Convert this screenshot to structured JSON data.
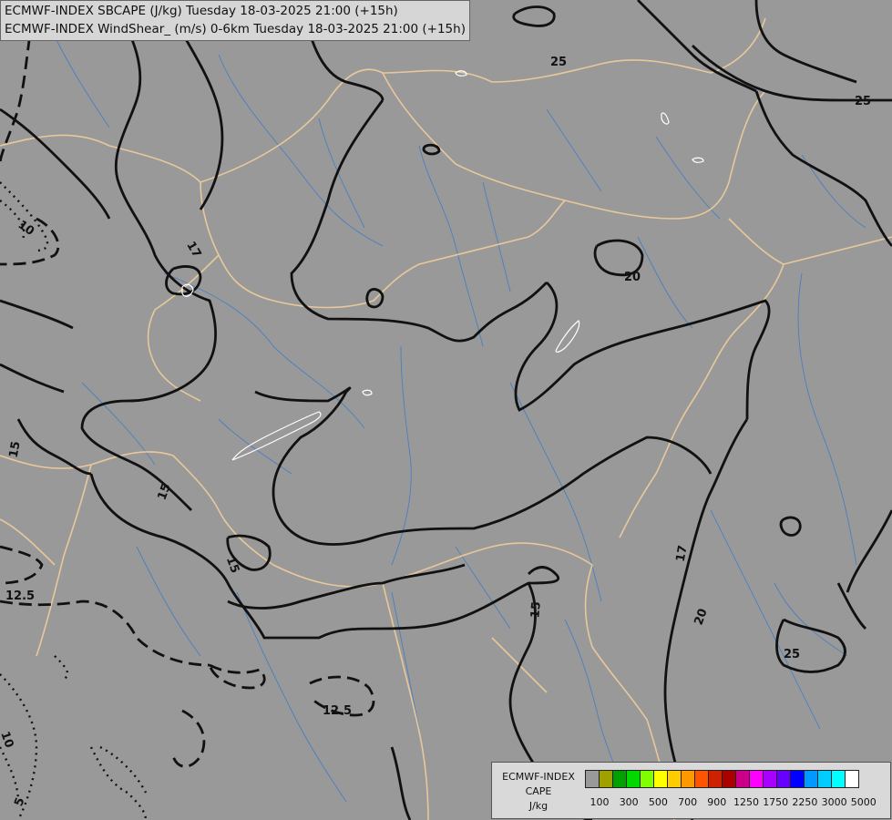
{
  "header": {
    "line1": "ECMWF-INDEX SBCAPE (J/kg) Tuesday 18-03-2025 21:00 (+15h)",
    "line2": "ECMWF-INDEX WindShear_ (m/s) 0-6km Tuesday 18-03-2025 21:00 (+15h)"
  },
  "map": {
    "background_color": "#999999",
    "border_color": "#e8c89a",
    "river_color": "#4a7fc0",
    "contour_labels": [
      "25",
      "25",
      "20",
      "17",
      "15",
      "15",
      "15",
      "15",
      "17",
      "20",
      "25",
      "10",
      "12.5",
      "12.5",
      "10",
      "5"
    ]
  },
  "legend": {
    "title": "ECMWF-INDEX",
    "quantity": "CAPE",
    "unit": "J/kg",
    "colors": [
      "#999999",
      "#a0a000",
      "#00a000",
      "#00d800",
      "#80ff00",
      "#ffff00",
      "#ffcc00",
      "#ff9900",
      "#ff5500",
      "#cc2200",
      "#aa0000",
      "#cc0088",
      "#ff00ff",
      "#aa00ff",
      "#6600ff",
      "#0000ff",
      "#0099ff",
      "#00ccff",
      "#00ffff",
      "#ffffff"
    ],
    "tick_labels": [
      "100",
      "300",
      "500",
      "700",
      "900",
      "1250",
      "1750",
      "2250",
      "3000",
      "5000"
    ]
  }
}
